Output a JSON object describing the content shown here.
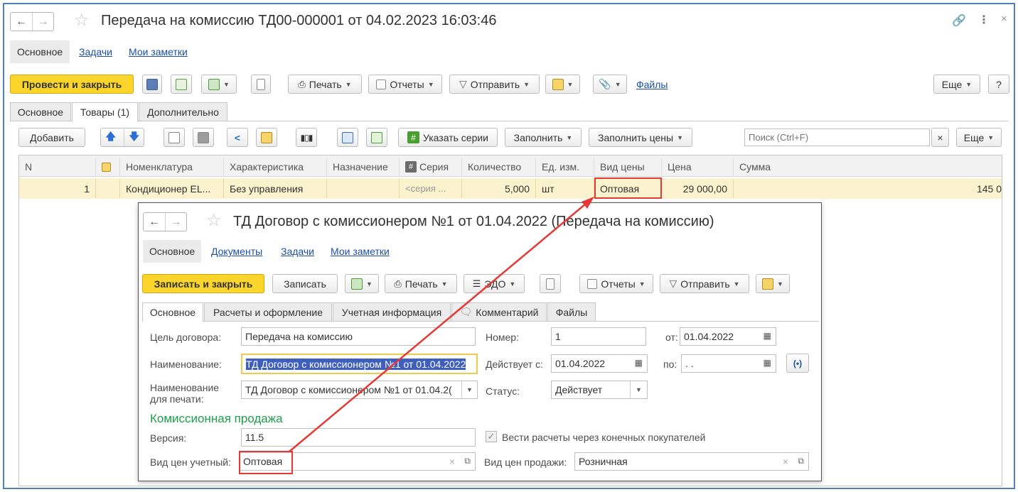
{
  "main": {
    "title": "Передача на комиссию ТД00-000001 от 04.02.2023 16:03:46",
    "nav": [
      "Основное",
      "Задачи",
      "Мои заметки"
    ],
    "toolbar": {
      "post_close": "Провести и закрыть",
      "print": "Печать",
      "reports": "Отчеты",
      "send": "Отправить",
      "files": "Файлы",
      "more": "Еще",
      "help": "?"
    },
    "tabs": [
      "Основное",
      "Товары (1)",
      "Дополнительно"
    ],
    "table_toolbar": {
      "add": "Добавить",
      "series": "Указать серии",
      "fill": "Заполнить",
      "fill_prices": "Заполнить цены",
      "search_placeholder": "Поиск (Ctrl+F)",
      "clear": "×",
      "more": "Еще"
    },
    "columns": [
      "N",
      "Номенклатура",
      "Характеристика",
      "Назначение",
      "Серия",
      "Количество",
      "Ед. изм.",
      "Вид цены",
      "Цена",
      "Сумма"
    ],
    "row": {
      "n": "1",
      "item": "Кондиционер EL...",
      "characteristic": "Без управления",
      "purpose": "",
      "series": "<серия ...",
      "qty": "5,000",
      "unit": "шт",
      "price_type": "Оптовая",
      "price": "29 000,00",
      "sum": "145 0"
    }
  },
  "dialog": {
    "title": "ТД Договор с комиссионером №1 от 01.04.2022 (Передача на комиссию)",
    "nav": [
      "Основное",
      "Документы",
      "Задачи",
      "Мои заметки"
    ],
    "toolbar": {
      "save_close": "Записать и закрыть",
      "save": "Записать",
      "print": "Печать",
      "edo": "ЭДО",
      "reports": "Отчеты",
      "send": "Отправить"
    },
    "tabs": [
      "Основное",
      "Расчеты и оформление",
      "Учетная информация",
      "Комментарий",
      "Файлы"
    ],
    "form": {
      "purpose_label": "Цель договора:",
      "purpose_value": "Передача на комиссию",
      "number_label": "Номер:",
      "number_value": "1",
      "from_label": "от:",
      "from_value": "01.04.2022",
      "name_label": "Наименование:",
      "name_value": "ТД Договор с комиссионером №1 от 01.04.2022",
      "valid_from_label": "Действует с:",
      "valid_from_value": "01.04.2022",
      "to_label": "по:",
      "to_value": " .  .",
      "print_name_label_1": "Наименование",
      "print_name_label_2": "для печати:",
      "print_name_value": "ТД Договор с комиссионером №1 от 01.04.2(",
      "status_label": "Статус:",
      "status_value": "Действует",
      "section": "Комиссионная продажа",
      "version_label": "Версия:",
      "version_value": "11.5",
      "checkbox_label": "Вести расчеты через конечных покупателей",
      "price_acc_label": "Вид цен учетный:",
      "price_acc_value": "Оптовая",
      "price_sale_label": "Вид цен продажи:",
      "price_sale_value": "Розничная"
    }
  },
  "colors": {
    "accent_yellow": "#fbd52b",
    "highlight_row": "#fbf3cd",
    "red_outline": "#e53935",
    "link_blue": "#1b4fa8",
    "section_green": "#1e9e49",
    "frame_blue": "#4f81bd"
  }
}
